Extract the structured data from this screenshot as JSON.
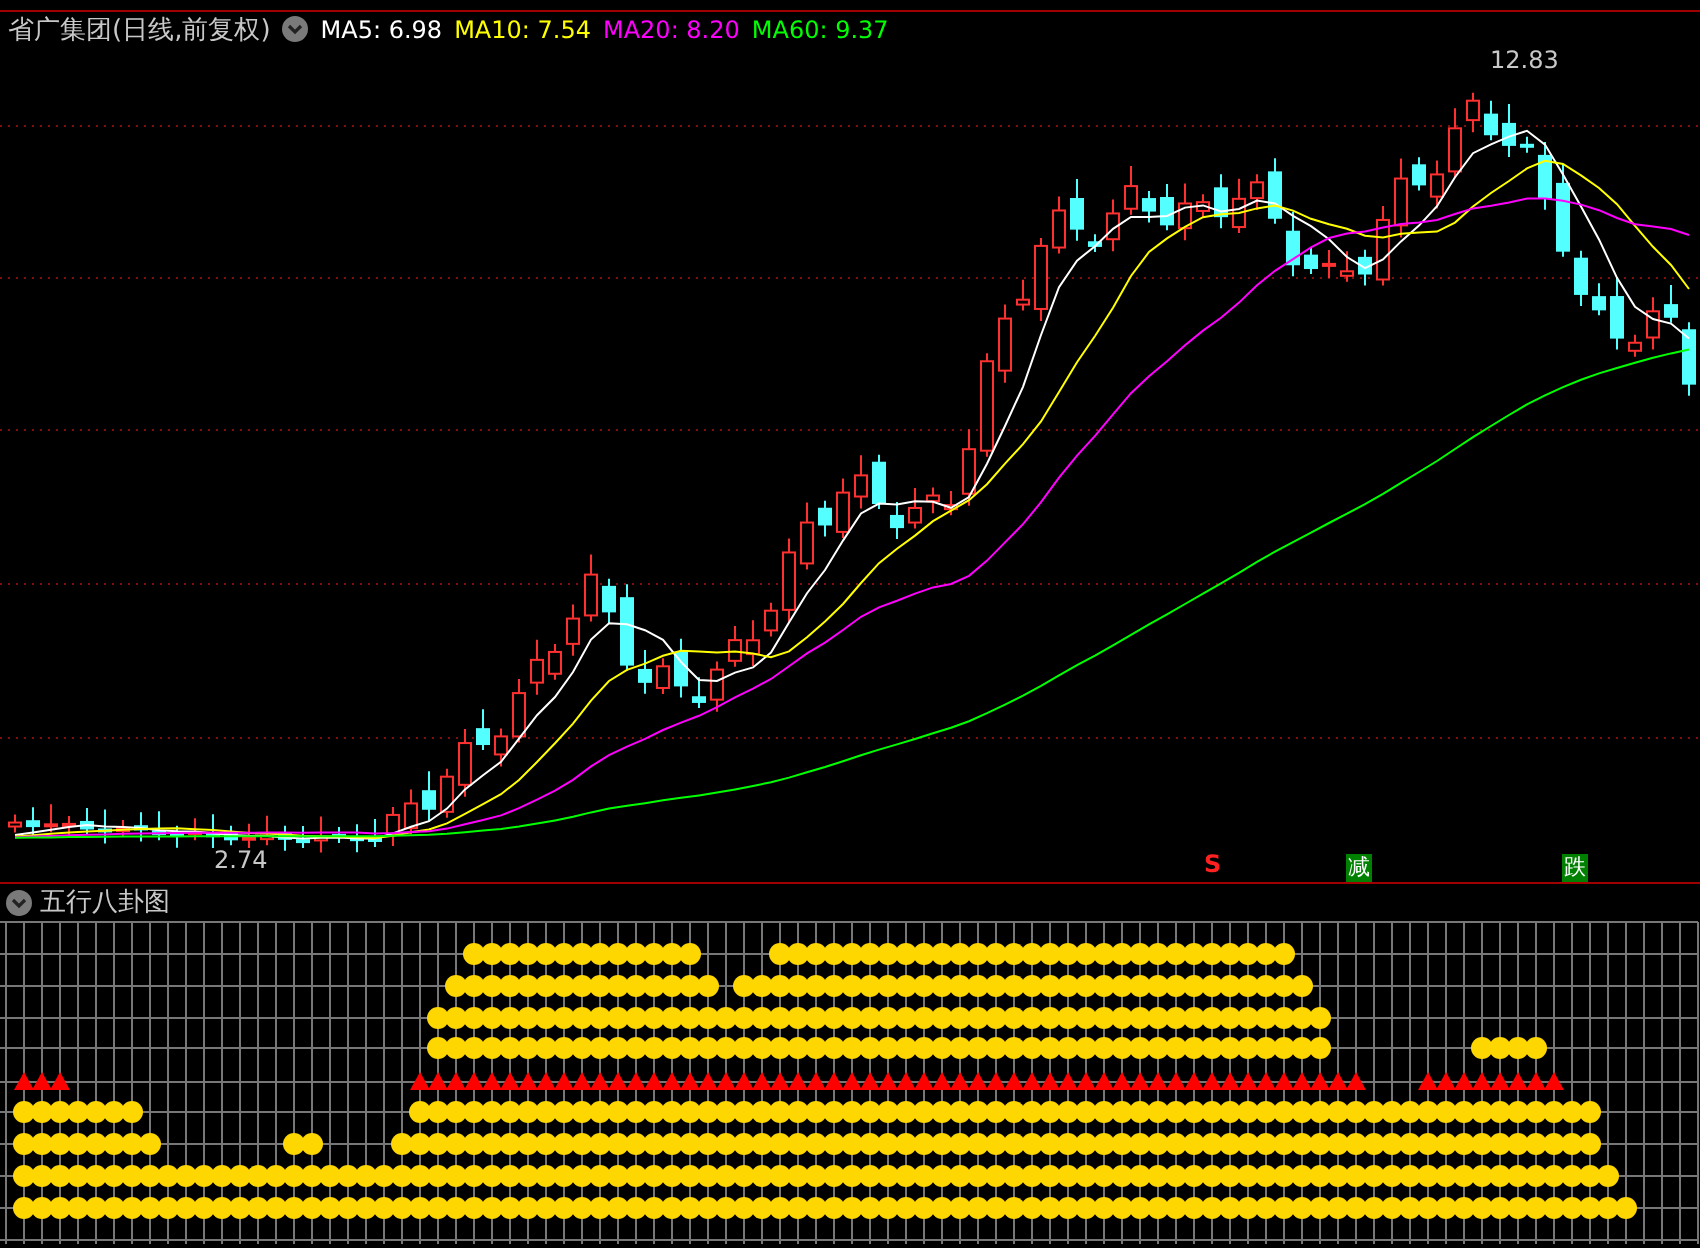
{
  "title": {
    "security": "省广集团(日线,前复权)",
    "averages": [
      {
        "label": "MA5: 6.98",
        "color": "#ffffff"
      },
      {
        "label": "MA10: 7.54",
        "color": "#ffff00"
      },
      {
        "label": "MA20: 8.20",
        "color": "#ff00ff"
      },
      {
        "label": "MA60: 9.37",
        "color": "#00ff00"
      }
    ]
  },
  "price_chart": {
    "high_label": "12.83",
    "low_label": "2.74",
    "signals": [
      {
        "kind": "sell",
        "text": "S"
      },
      {
        "kind": "badge",
        "text": "减"
      },
      {
        "kind": "badge",
        "text": "跌"
      }
    ]
  },
  "indicator": {
    "title": "五行八卦图"
  }
}
